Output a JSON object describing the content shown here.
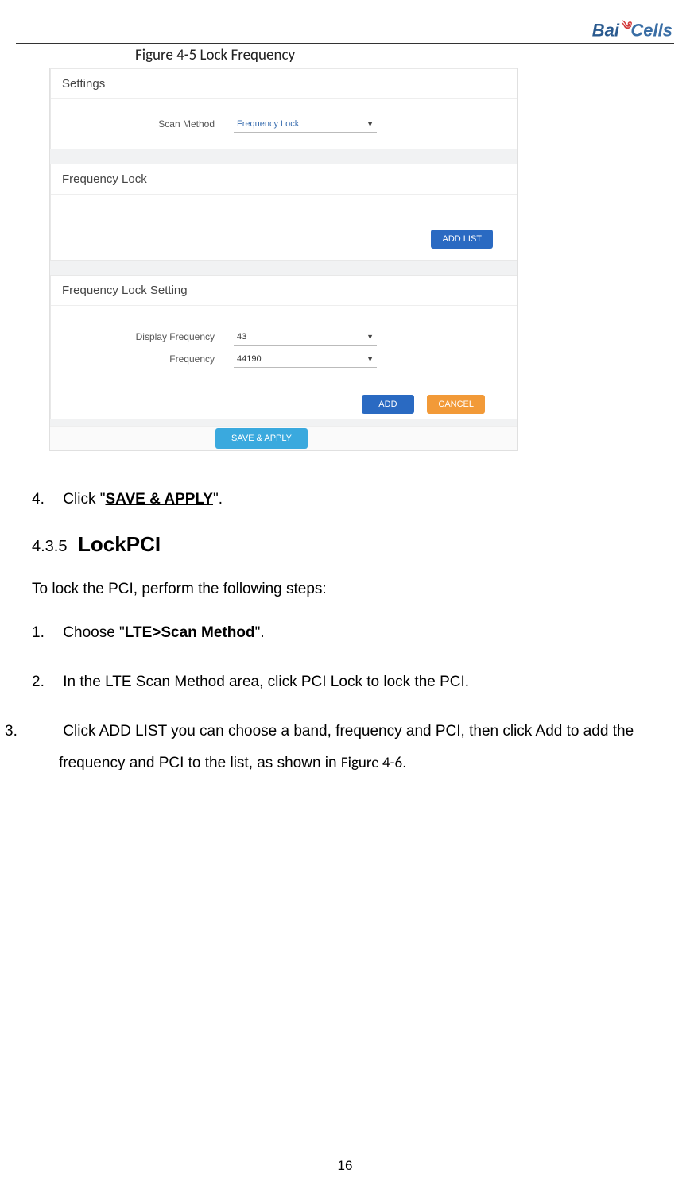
{
  "header": {
    "logo_bai": "Bai",
    "logo_cells": "Cells"
  },
  "figure": {
    "caption": "Figure 4-5 Lock Frequency"
  },
  "settings_panel": {
    "title": "Settings",
    "scan_method_label": "Scan Method",
    "scan_method_value": "Frequency Lock"
  },
  "freqlock_panel": {
    "title": "Frequency Lock",
    "add_list_btn": "ADD LIST"
  },
  "freqlock_setting_panel": {
    "title": "Frequency Lock Setting",
    "display_freq_label": "Display Frequency",
    "display_freq_value": "43",
    "freq_label": "Frequency",
    "freq_value": "44190",
    "add_btn": "ADD",
    "cancel_btn": "CANCEL"
  },
  "save_apply_btn": "SAVE & APPLY",
  "step4": {
    "num": "4.",
    "pre": "Click \"",
    "bold": "SAVE & APPLY",
    "post": "\"."
  },
  "section": {
    "num": "4.3.5",
    "title": "LockPCI"
  },
  "intro": "To lock the PCI, perform the following steps:",
  "steps": {
    "s1": {
      "num": "1.",
      "pre": "Choose \"",
      "bold": "LTE>Scan Method",
      "post": "\"."
    },
    "s2": {
      "num": "2.",
      "text": "In the LTE Scan Method area, click PCI Lock to lock the PCI."
    },
    "s3": {
      "num": "3.",
      "text_a": "Click ADD LIST you can choose a band, frequency and PCI, then click Add to add the frequency and PCI to the list, as shown in ",
      "figref": "Figure 4-6",
      "text_b": "."
    }
  },
  "page_number": "16"
}
